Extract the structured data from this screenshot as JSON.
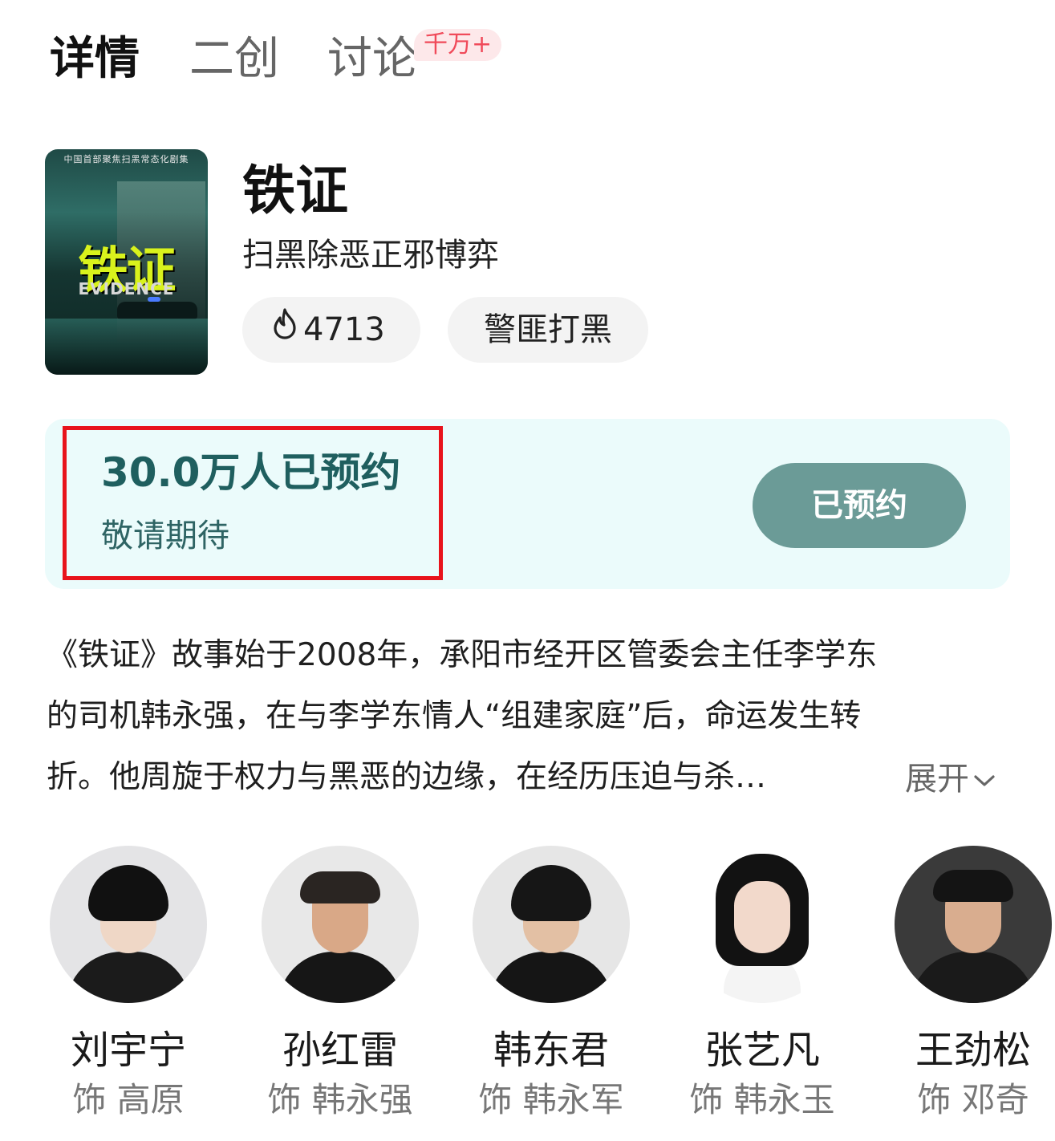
{
  "tabs": [
    {
      "label": "详情",
      "active": true
    },
    {
      "label": "二创",
      "active": false
    },
    {
      "label": "讨论",
      "active": false,
      "badge": "千万+"
    }
  ],
  "show": {
    "poster": {
      "top_strip": "中国首部聚焦扫黑常态化剧集",
      "title_text": "铁证",
      "subtitle_text": "EVIDENCE"
    },
    "title": "铁证",
    "subtitle": "扫黑除恶正邪博弈",
    "heat": {
      "icon": "flame-icon",
      "value": "4713"
    },
    "tag": "警匪打黑"
  },
  "reservation": {
    "count_text": "30.0万人已预约",
    "note": "敬请期待",
    "button_label": "已预约",
    "highlight_color": "#e8131b",
    "button_color": "#6b9b97"
  },
  "description": {
    "lines": [
      "《铁证》故事始于2008年，承阳市经开区管委会主任李学东",
      "的司机韩永强，在与李学东情人“组建家庭”后，命运发生转",
      "折。他周旋于权力与黑恶的边缘，在经历压迫与杀…"
    ],
    "expand_label": "展开"
  },
  "cast": [
    {
      "name": "刘宇宁",
      "role": "饰 高原"
    },
    {
      "name": "孙红雷",
      "role": "饰 韩永强"
    },
    {
      "name": "韩东君",
      "role": "饰 韩永军"
    },
    {
      "name": "张艺凡",
      "role": "饰 韩永玉"
    },
    {
      "name": "王劲松",
      "role": "饰 邓奇"
    }
  ]
}
